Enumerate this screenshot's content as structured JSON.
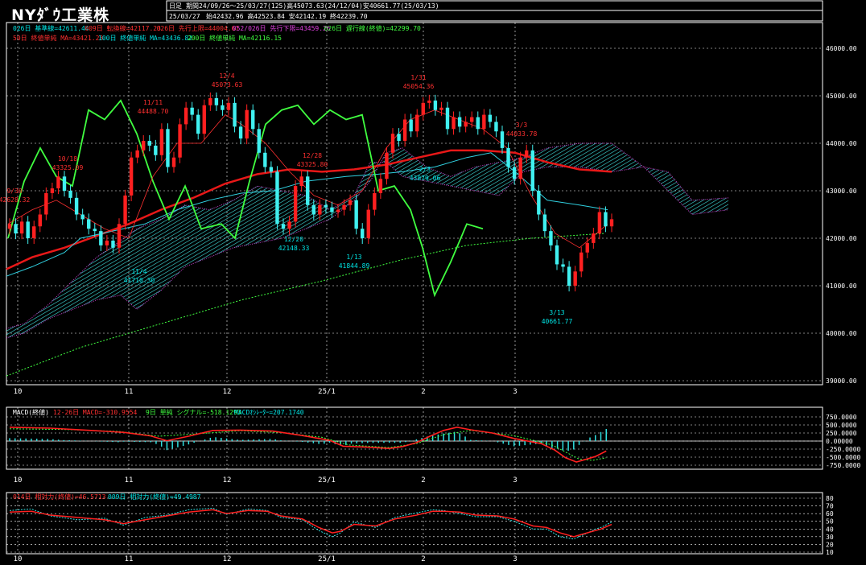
{
  "header": {
    "title": "NYﾀﾞｳ工業株",
    "chart_kind": "日足",
    "period_line": "期間24/09/26～25/03/27(125)高45073.63(24/12/04)安40661.77(25/03/13)",
    "date": "25/03/27",
    "ohlc_line": "始42432.96 高42523.84 安42142.19 終42239.70"
  },
  "legends": {
    "line1": [
      {
        "text": "026日 基準線=42611.44",
        "color": "#00e5e5"
      },
      {
        "text": "009日 転換線=42117.23",
        "color": "#ff3030"
      },
      {
        "text": "026日 先行上限=44004.67",
        "color": "#ff3030"
      },
      {
        "text": "052/026日 先行下限=43459.26",
        "color": "#e040e0"
      },
      {
        "text": "026日 遅行線(終値)=42299.70",
        "color": "#40ff40"
      }
    ],
    "line2": [
      {
        "text": "50日 終値単純 MA=43421.23",
        "color": "#ff3030"
      },
      {
        "text": "100日 終値単純 MA=43436.82",
        "color": "#00e5e5"
      },
      {
        "text": "200日 終値単純 MA=42116.15",
        "color": "#40ff40"
      }
    ],
    "macd": [
      {
        "text": "MACD(終値)",
        "color": "#ffffff"
      },
      {
        "text": "12-26日 MACD=-310.9554",
        "color": "#ff3030"
      },
      {
        "text": "9日 単純 シグナル=-518.1293",
        "color": "#40ff40"
      },
      {
        "text": "MACDｵｼﾚｰﾀｰ=207.1740",
        "color": "#00e5e5"
      }
    ],
    "rsi": [
      {
        "text": "014日 相対力(終値)=46.5713",
        "color": "#ff3030"
      },
      {
        "text": "009日 相対力(終値)=49.4987",
        "color": "#00e5e5"
      }
    ]
  },
  "x_ticks": [
    "10",
    "11",
    "12",
    "25/1",
    "2",
    "3"
  ],
  "chart_data": [
    {
      "type": "candlestick",
      "ylim": [
        39000,
        46500
      ],
      "ytick_labels": [
        "39000.00",
        "40000.00",
        "41000.00",
        "42000.00",
        "43000.00",
        "44000.00",
        "45000.00",
        "46000.00"
      ],
      "annotations": [
        {
          "text": "9/30",
          "value": "42628.32",
          "color": "#ff3030"
        },
        {
          "text": "10/18",
          "value": "43325.09",
          "color": "#ff3030"
        },
        {
          "text": "11/11",
          "value": "44488.70",
          "color": "#ff3030"
        },
        {
          "text": "12/4",
          "value": "45073.63",
          "color": "#ff3030"
        },
        {
          "text": "12/28",
          "value": "43325.80",
          "color": "#ff3030"
        },
        {
          "text": "12/20",
          "value": "42148.33",
          "color": "#00e5e5"
        },
        {
          "text": "1/13",
          "value": "41844.89",
          "color": "#00e5e5"
        },
        {
          "text": "1/31",
          "value": "45054.36",
          "color": "#ff3030"
        },
        {
          "text": "2/3",
          "value": "43879.06",
          "color": "#00e5e5"
        },
        {
          "text": "3/3",
          "value": "44033.78",
          "color": "#ff3030"
        },
        {
          "text": "11/4",
          "value": "41710.30",
          "color": "#00e5e5"
        },
        {
          "text": "3/13",
          "value": "40661.77",
          "color": "#00e5e5"
        }
      ],
      "closes": [
        42300,
        42100,
        42350,
        42000,
        42250,
        42500,
        42950,
        43050,
        43300,
        43000,
        42850,
        42500,
        42400,
        42200,
        42150,
        41850,
        41950,
        41800,
        42300,
        42900,
        43700,
        43850,
        44050,
        43950,
        43750,
        44300,
        43500,
        43700,
        44400,
        44750,
        44600,
        44200,
        44800,
        44950,
        44800,
        44700,
        44850,
        44350,
        44100,
        44700,
        44300,
        43800,
        43500,
        43400,
        42300,
        42200,
        42350,
        43100,
        43300,
        42700,
        42500,
        42700,
        42650,
        42550,
        42600,
        42700,
        42800,
        42200,
        42000,
        42600,
        42950,
        43250,
        43800,
        44200,
        44050,
        44500,
        44250,
        44600,
        44850,
        44900,
        44700,
        44750,
        44300,
        44550,
        44350,
        44450,
        44550,
        44300,
        44600,
        44450,
        44250,
        43900,
        43500,
        43250,
        43700,
        43850,
        43000,
        42500,
        42150,
        41850,
        41450,
        41400,
        41000,
        41300,
        41700,
        41900,
        42100,
        42550,
        42250,
        42400
      ]
    },
    {
      "type": "line",
      "title": "MACD",
      "ytick_labels": [
        "750.0000",
        "500.0000",
        "250.0000",
        "0.00000",
        "-250.0000",
        "-500.0000",
        "-750.0000"
      ],
      "ylim": [
        -830,
        830
      ],
      "macd_points": [
        [
          0,
          430
        ],
        [
          15,
          400
        ],
        [
          30,
          330
        ],
        [
          42,
          270
        ],
        [
          52,
          160
        ],
        [
          58,
          10
        ],
        [
          66,
          150
        ],
        [
          75,
          330
        ],
        [
          85,
          340
        ],
        [
          97,
          310
        ],
        [
          108,
          170
        ],
        [
          118,
          20
        ],
        [
          123,
          -160
        ],
        [
          132,
          -190
        ],
        [
          140,
          -230
        ],
        [
          145,
          -170
        ],
        [
          150,
          -50
        ],
        [
          155,
          150
        ],
        [
          160,
          330
        ],
        [
          165,
          430
        ],
        [
          170,
          350
        ],
        [
          178,
          250
        ],
        [
          186,
          80
        ],
        [
          196,
          -80
        ],
        [
          201,
          -280
        ],
        [
          205,
          -520
        ],
        [
          209,
          -650
        ],
        [
          212,
          -580
        ],
        [
          216,
          -480
        ],
        [
          220,
          -310
        ]
      ],
      "signal_points": [
        [
          0,
          380
        ],
        [
          20,
          360
        ],
        [
          40,
          300
        ],
        [
          55,
          150
        ],
        [
          70,
          230
        ],
        [
          85,
          320
        ],
        [
          100,
          260
        ],
        [
          115,
          120
        ],
        [
          125,
          -120
        ],
        [
          140,
          -200
        ],
        [
          150,
          -80
        ],
        [
          160,
          200
        ],
        [
          170,
          330
        ],
        [
          186,
          170
        ],
        [
          200,
          -120
        ],
        [
          210,
          -560
        ],
        [
          215,
          -600
        ],
        [
          220,
          -518
        ]
      ]
    },
    {
      "type": "line",
      "title": "RSI",
      "ylim": [
        10,
        80
      ],
      "ytick_labels": [
        "80",
        "70",
        "60",
        "50",
        "40",
        "30",
        "20",
        "10"
      ],
      "rsi14_points": [
        [
          0,
          62
        ],
        [
          8,
          63
        ],
        [
          15,
          58
        ],
        [
          25,
          55
        ],
        [
          35,
          52
        ],
        [
          42,
          47
        ],
        [
          50,
          52
        ],
        [
          58,
          57
        ],
        [
          66,
          62
        ],
        [
          75,
          65
        ],
        [
          80,
          60
        ],
        [
          88,
          64
        ],
        [
          95,
          63
        ],
        [
          100,
          57
        ],
        [
          108,
          53
        ],
        [
          114,
          42
        ],
        [
          119,
          35
        ],
        [
          122,
          37
        ],
        [
          127,
          46
        ],
        [
          135,
          44
        ],
        [
          142,
          53
        ],
        [
          150,
          58
        ],
        [
          156,
          63
        ],
        [
          160,
          63
        ],
        [
          166,
          62
        ],
        [
          172,
          58
        ],
        [
          180,
          57
        ],
        [
          186,
          53
        ],
        [
          193,
          44
        ],
        [
          198,
          42
        ],
        [
          203,
          35
        ],
        [
          208,
          30
        ],
        [
          212,
          34
        ],
        [
          216,
          38
        ],
        [
          218,
          40
        ],
        [
          222,
          46
        ]
      ],
      "rsi9_points": [
        [
          0,
          64
        ],
        [
          8,
          66
        ],
        [
          15,
          57
        ],
        [
          25,
          52
        ],
        [
          35,
          54
        ],
        [
          42,
          45
        ],
        [
          50,
          55
        ],
        [
          58,
          58
        ],
        [
          66,
          65
        ],
        [
          75,
          67
        ],
        [
          80,
          59
        ],
        [
          88,
          66
        ],
        [
          95,
          64
        ],
        [
          100,
          55
        ],
        [
          108,
          52
        ],
        [
          114,
          38
        ],
        [
          119,
          30
        ],
        [
          122,
          35
        ],
        [
          127,
          49
        ],
        [
          135,
          42
        ],
        [
          142,
          55
        ],
        [
          150,
          61
        ],
        [
          156,
          65
        ],
        [
          160,
          64
        ],
        [
          166,
          60
        ],
        [
          172,
          56
        ],
        [
          180,
          56
        ],
        [
          186,
          50
        ],
        [
          193,
          40
        ],
        [
          198,
          40
        ],
        [
          203,
          30
        ],
        [
          208,
          27
        ],
        [
          212,
          33
        ],
        [
          216,
          40
        ],
        [
          218,
          42
        ],
        [
          222,
          49
        ]
      ]
    }
  ]
}
